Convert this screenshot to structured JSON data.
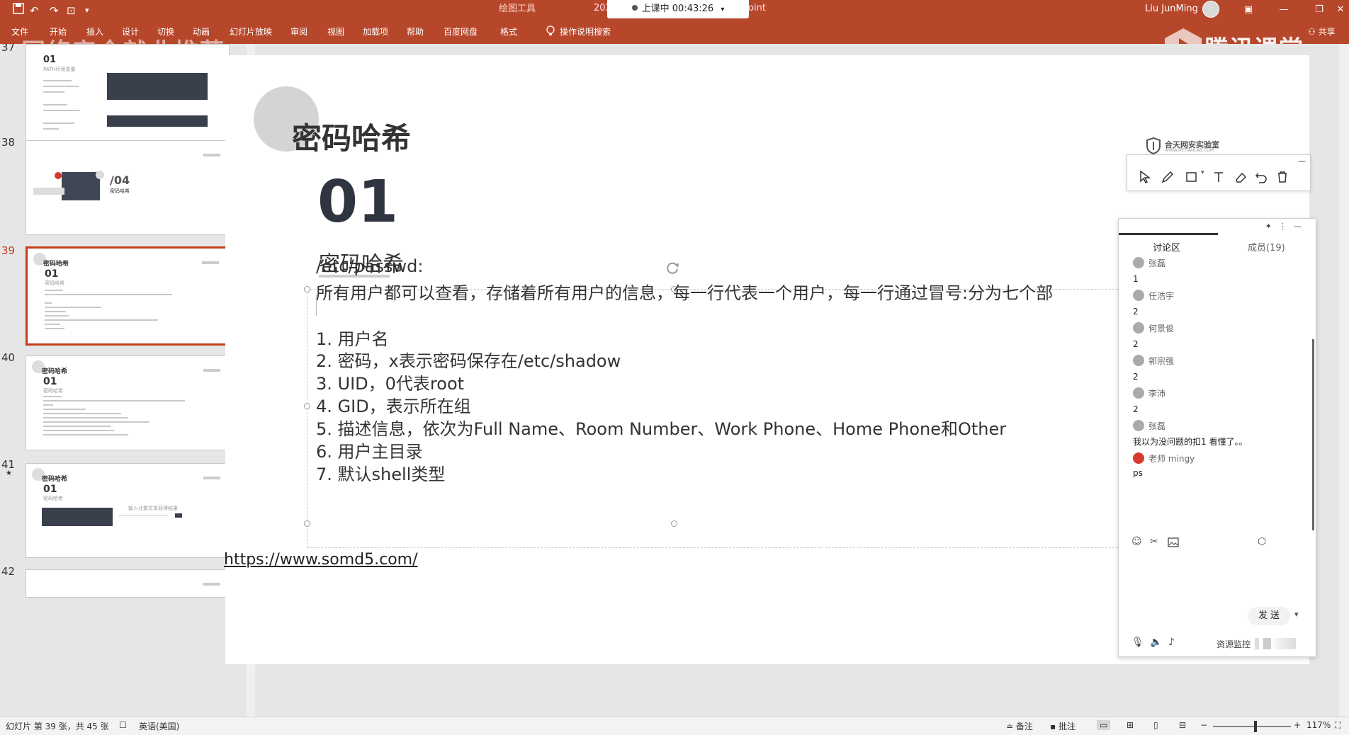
{
  "ribbon": {
    "context_tab": "绘图工具",
    "title_left": "202",
    "title_right": "oint",
    "live_status": "上课中 00:43:26",
    "user_name": "Liu JunMing",
    "menu": [
      "文件",
      "开始",
      "插入",
      "设计",
      "切换",
      "动画",
      "幻灯片放映",
      "审阅",
      "视图",
      "加载项",
      "帮助",
      "百度网盘",
      "格式",
      "操作说明搜索"
    ],
    "share": "共享",
    "watermark": "网络安全就业推荐",
    "brand": "腾讯课堂"
  },
  "thumbnails": [
    {
      "num": "37",
      "subtitle": "PATH环境变量",
      "title": "01"
    },
    {
      "num": "38",
      "title": "/04",
      "subtitle": "密码哈希"
    },
    {
      "num": "39",
      "title": "密码哈希",
      "big": "01",
      "subtitle": "密码哈希"
    },
    {
      "num": "40",
      "title": "密码哈希",
      "big": "01",
      "subtitle": "密码哈希"
    },
    {
      "num": "41",
      "star": "★",
      "title": "密码哈希",
      "big": "01",
      "subtitle": "密码哈希",
      "caption": "输入计算文本获得结果"
    },
    {
      "num": "42"
    }
  ],
  "slide": {
    "title": "密码哈希",
    "logo_name": "合天网安实验室",
    "logo_url": "WWW.HETIANLAB.COM",
    "big_number": "01",
    "big_number_sub": "密码哈希",
    "lines": [
      "/etc/passwd:",
      "所有用户都可以查看，存储着所有用户的信息，每一行代表一个用户，每一行通过冒号:分为七个部",
      "1. 用户名",
      "2. 密码，x表示密码保存在/etc/shadow",
      "3. UID，0代表root",
      "4. GID，表示所在组",
      "5. 描述信息，依次为Full Name、Room Number、Work Phone、Home Phone和Other",
      "6. 用户主目录",
      "7. 默认shell类型"
    ]
  },
  "notes": {
    "url": "https://www.somd5.com/"
  },
  "chat": {
    "tab_discuss": "讨论区",
    "tab_members": "成员(19)",
    "messages": [
      {
        "name": "张磊",
        "body": "1"
      },
      {
        "name": "任浩宇",
        "body": "2"
      },
      {
        "name": "何景俊",
        "body": "2"
      },
      {
        "name": "郭宗强",
        "body": "2"
      },
      {
        "name": "李沛",
        "body": "2"
      },
      {
        "name": "张磊",
        "body": "我以为没问题的扣1  看懂了。。"
      },
      {
        "name": "老师 mingy",
        "body": "ps"
      }
    ],
    "send": "发 送",
    "resource_label": "资源监控"
  },
  "statusbar": {
    "slide_info": "幻灯片 第 39 张，共 45 张",
    "language": "英语(美国)",
    "notes": "备注",
    "comments": "批注",
    "zoom": "117%"
  },
  "colors": {
    "ribbon": "#b7472a",
    "active_thumb": "#c43e1c"
  }
}
